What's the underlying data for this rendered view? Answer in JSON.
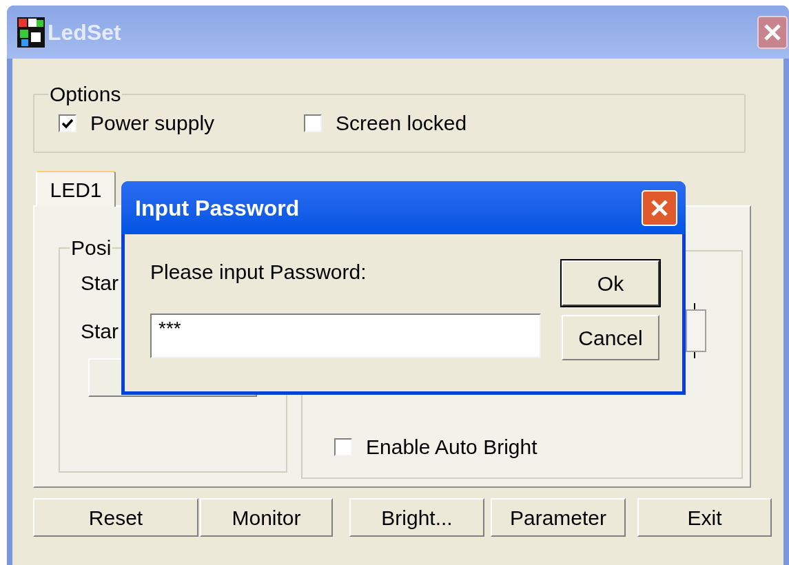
{
  "window": {
    "title": "LedSet"
  },
  "options": {
    "title": "Options",
    "checkboxes": [
      {
        "label": "Power supply",
        "checked": true
      },
      {
        "label": "Screen locked",
        "checked": false
      }
    ]
  },
  "tabs": [
    {
      "label": "LED1",
      "selected": true
    }
  ],
  "position_group": {
    "title": "Posi",
    "labels": [
      "Star",
      "Star"
    ]
  },
  "bright_group": {
    "checkbox": {
      "label": "Enable Auto Bright",
      "checked": false
    }
  },
  "buttons": [
    "Reset",
    "Monitor",
    "Bright...",
    "Parameter",
    "Exit"
  ],
  "dialog": {
    "title": "Input Password",
    "prompt": "Please input Password:",
    "password": {
      "value": "***"
    },
    "buttons": [
      {
        "label": "Ok",
        "default": true
      },
      {
        "label": "Cancel",
        "default": false
      }
    ]
  }
}
